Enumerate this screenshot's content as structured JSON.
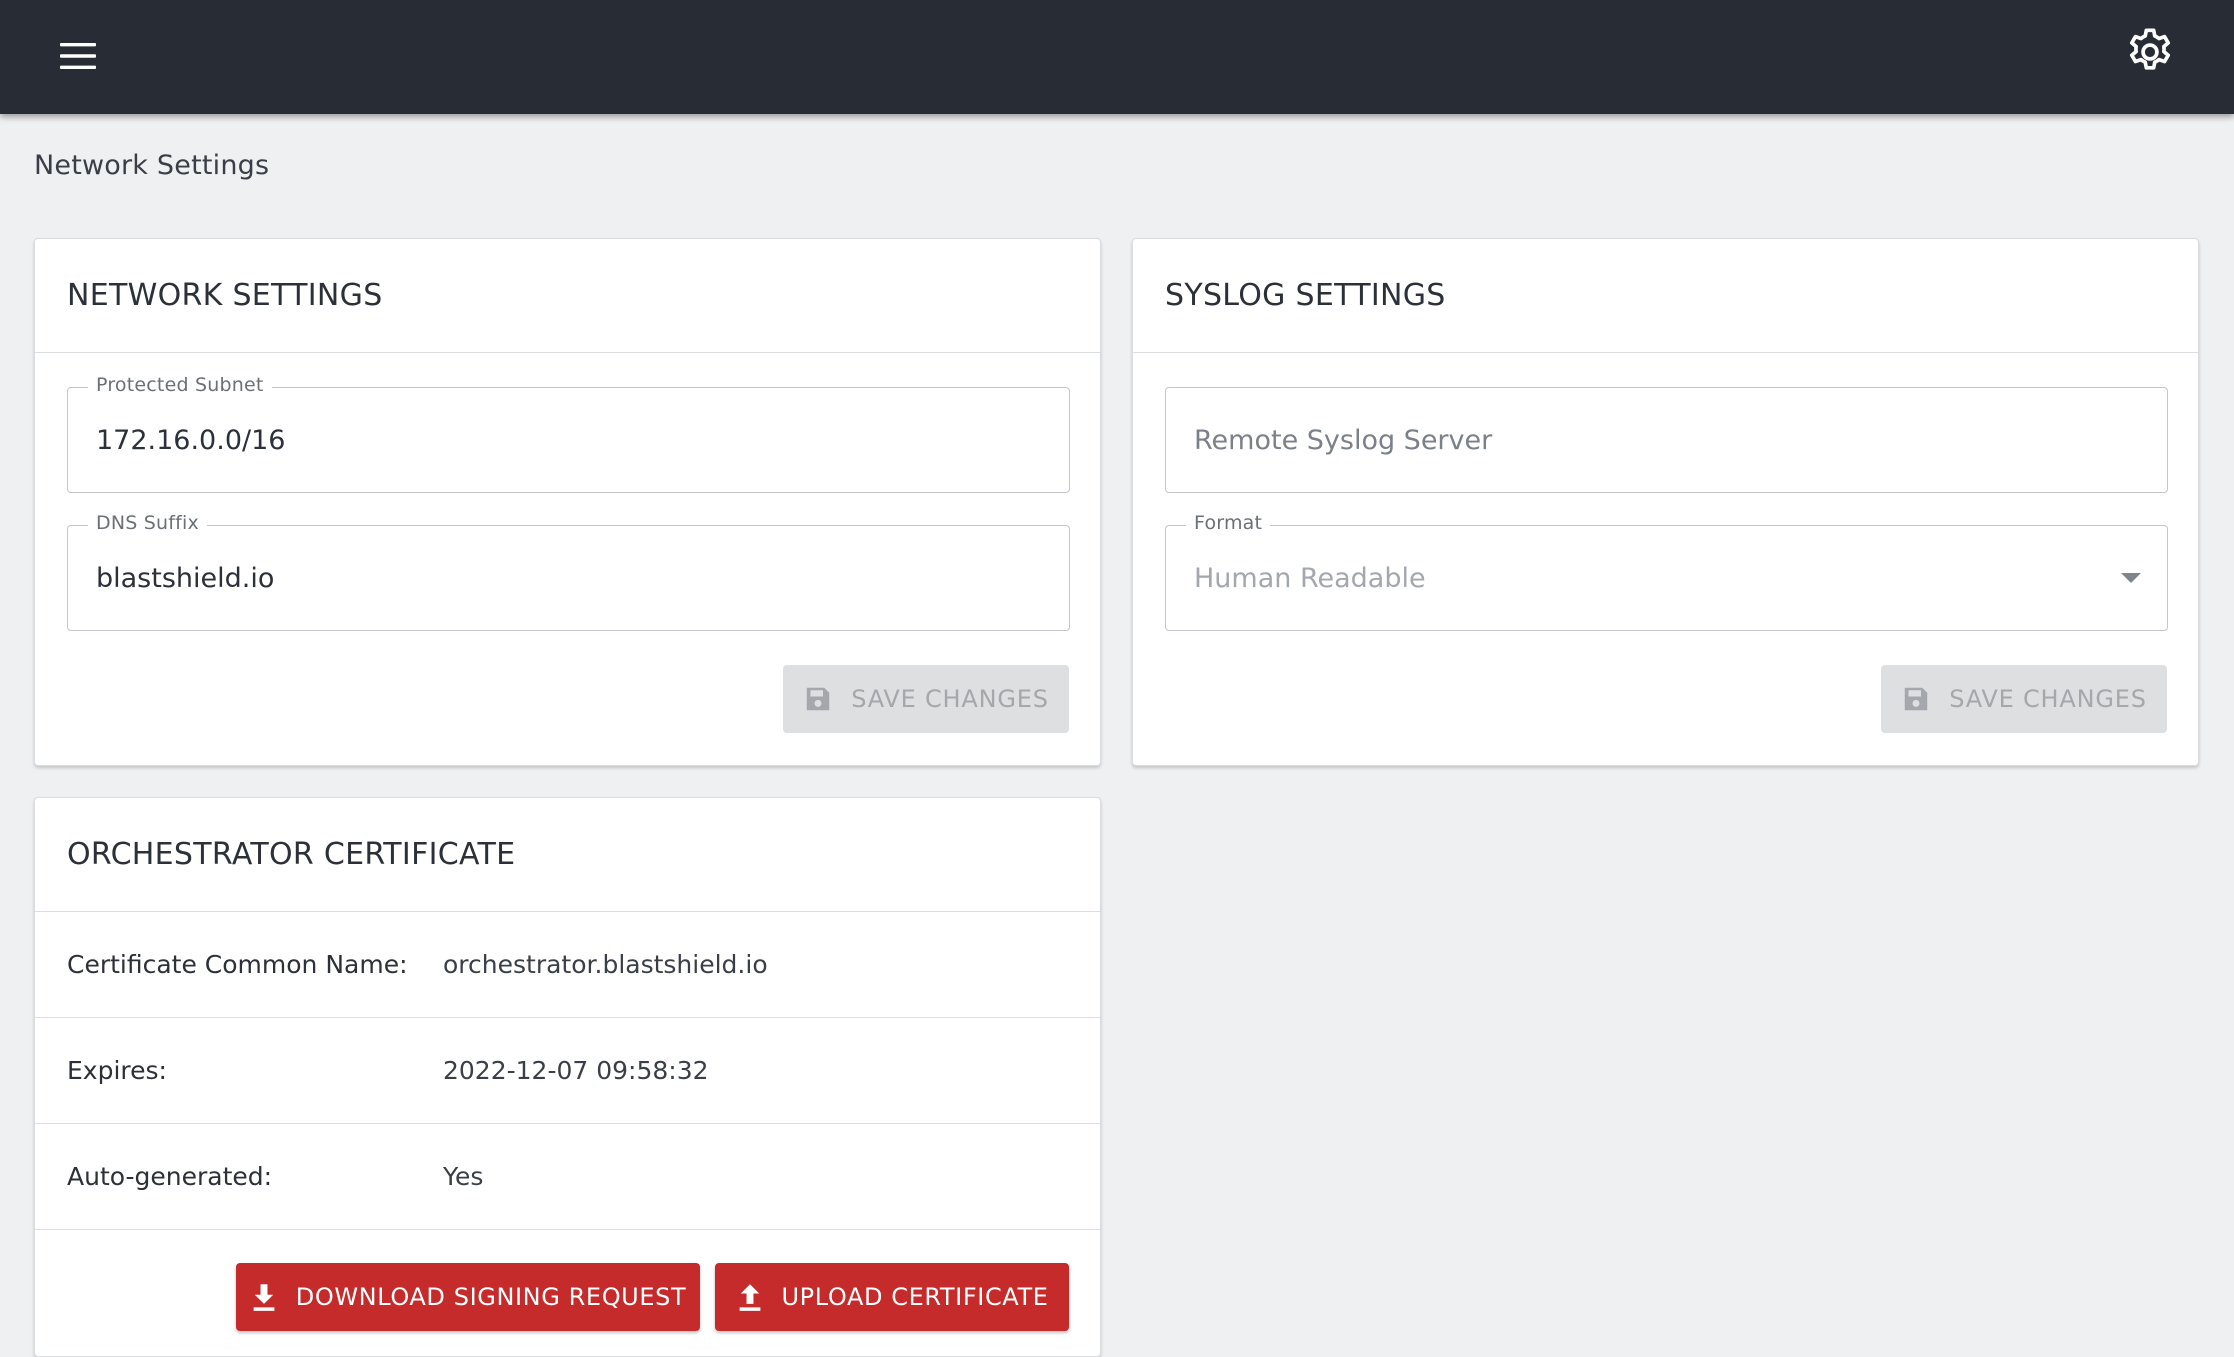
{
  "topbar": {
    "menu_icon": "hamburger-menu-icon",
    "settings_icon": "gear-icon"
  },
  "page": {
    "title": "Network Settings"
  },
  "network_settings": {
    "title": "NETWORK SETTINGS",
    "protected_subnet": {
      "label": "Protected Subnet",
      "value": "172.16.0.0/16"
    },
    "dns_suffix": {
      "label": "DNS Suffix",
      "value": "blastshield.io"
    },
    "save_label": "SAVE CHANGES"
  },
  "syslog_settings": {
    "title": "SYSLOG SETTINGS",
    "remote_server": {
      "placeholder": "Remote Syslog Server",
      "value": ""
    },
    "format": {
      "label": "Format",
      "value": "Human Readable"
    },
    "save_label": "SAVE CHANGES"
  },
  "orchestrator_certificate": {
    "title": "ORCHESTRATOR CERTIFICATE",
    "rows": [
      {
        "label": "Certificate Common Name:",
        "value": "orchestrator.blastshield.io"
      },
      {
        "label": "Expires:",
        "value": "2022-12-07 09:58:32"
      },
      {
        "label": "Auto-generated:",
        "value": "Yes"
      }
    ],
    "download_label": "DOWNLOAD SIGNING REQUEST",
    "upload_label": "UPLOAD CERTIFICATE"
  },
  "colors": {
    "topbar": "#282c34",
    "background": "#eff0f2",
    "accent_red": "#c62b2b",
    "disabled_button": "#dedfe1"
  }
}
